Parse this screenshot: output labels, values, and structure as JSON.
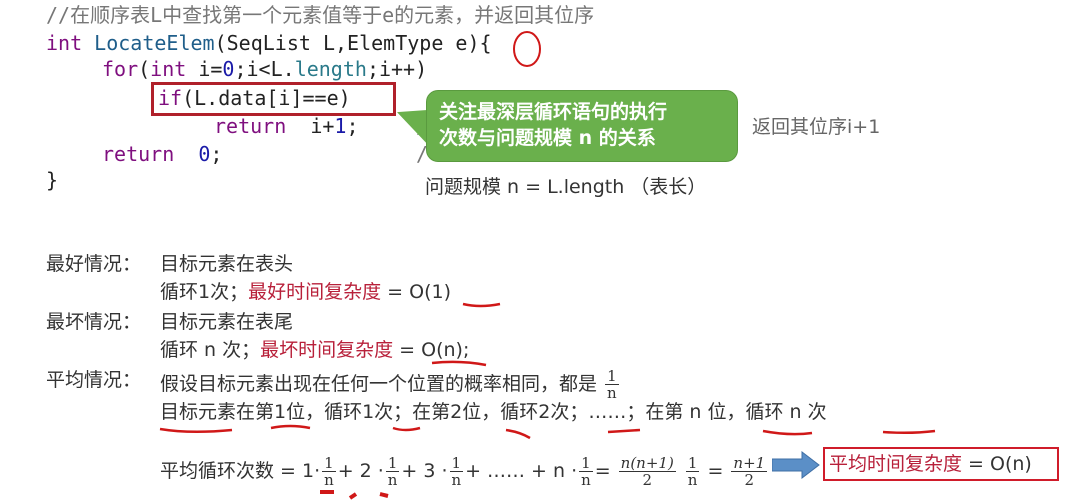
{
  "code": {
    "comment": "//在顺序表L中查找第一个元素值等于e的元素，并返回其位序",
    "line1": {
      "kw": "int",
      "fn": "LocateElem",
      "args_pre": "(SeqList L,ElemType ",
      "param": "e",
      "args_post": "){"
    },
    "line2": {
      "kw": "for",
      "open": "(",
      "kw2": "int",
      "mid": " i=",
      "zero": "0",
      "cond": ";i<L.",
      "field": "length",
      "end": ";i++)"
    },
    "line3": {
      "kw": "if",
      "rest": "(L.data[i]==e)"
    },
    "line4": {
      "kw": "return",
      "expr_pre": "  i+",
      "one": "1",
      "semi": ";"
    },
    "line5": {
      "kw": "return",
      "zero": "  0",
      "semi": ";"
    },
    "line6": "}",
    "line4_comment": "返回其位序i+1"
  },
  "callout": {
    "line1": "关注最深层循环语句的执行",
    "line2": "次数与问题规模 n 的关系"
  },
  "problem_size": "问题规模 n = L.length （表长）",
  "best": {
    "label": "最好情况：",
    "desc": "目标元素在表头",
    "loops": "循环1次；",
    "complexity_label": "最好时间复杂度",
    "complexity_value": " = O(1)"
  },
  "worst": {
    "label": "最坏情况：",
    "desc": "目标元素在表尾",
    "loops": "循环 n 次；",
    "complexity_label": "最坏时间复杂度",
    "complexity_value": " = O(n);"
  },
  "average": {
    "label": "平均情况：",
    "desc": "假设目标元素出现在任何一个位置的概率相同，都是",
    "prob_num": "1",
    "prob_den": "n",
    "cases": "目标元素在第1位，循环1次；在第2位，循环2次；……；在第 n 位，循环 n 次",
    "formula_label": "平均循环次数 = ",
    "terms": [
      {
        "coef": "1·",
        "num": "1",
        "den": "n",
        "op": "+"
      },
      {
        "coef": "2 ·",
        "num": "1",
        "den": "n",
        "op": "+"
      },
      {
        "coef": "3 ·",
        "num": "1",
        "den": "n",
        "op": "+ …… +"
      },
      {
        "coef": "n ·",
        "num": "1",
        "den": "n",
        "op": "="
      }
    ],
    "sum_num": "n(n+1)",
    "sum_den": "2",
    "sum_mult_num": "1",
    "sum_mult_den": "n",
    "eq": "=",
    "final_num": "n+1",
    "final_den": "2",
    "result_label": "平均时间复杂度",
    "result_value": " = O(n)"
  },
  "colors": {
    "keyword": "#7f0f7f",
    "function": "#1f5e8a",
    "number": "#1a1aa8",
    "highlight_red": "#b8203a",
    "callout_green": "#6ab04c",
    "arrow_blue": "#5b8fc7"
  }
}
